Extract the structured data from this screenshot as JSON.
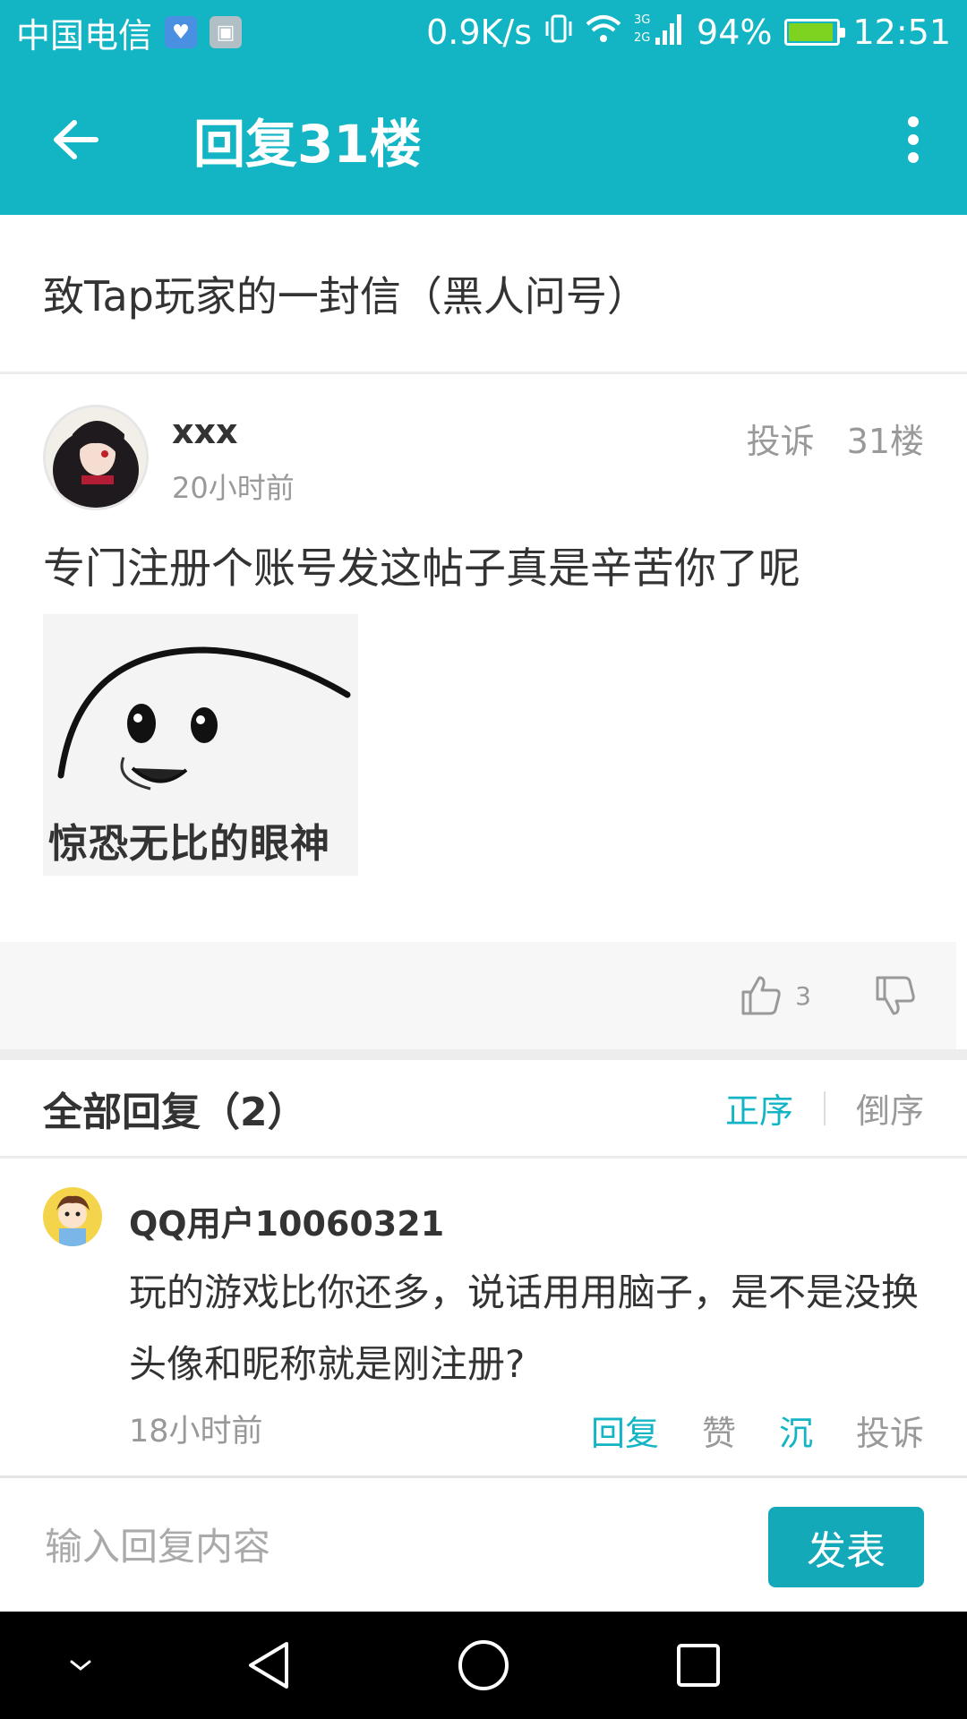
{
  "status_bar": {
    "carrier": "中国电信",
    "net_speed": "0.9K/s",
    "network": "3G 2G",
    "battery": "94%",
    "time": "12:51"
  },
  "app_bar": {
    "title": "回复31楼"
  },
  "post": {
    "title": "致Tap玩家的一封信（黑人问号）",
    "username": "xxx",
    "time": "20小时前",
    "report_label": "投诉",
    "floor": "31楼",
    "body": "专门注册个账号发这帖子真是辛苦你了呢",
    "image_caption": "惊恐无比的眼神",
    "like_count": "3"
  },
  "replies": {
    "header": "全部回复（2）",
    "sort_asc": "正序",
    "sort_desc": "倒序",
    "items": [
      {
        "username": "QQ用户10060321",
        "text": "玩的游戏比你还多，说话用用脑子，是不是没换头像和昵称就是刚注册?",
        "time": "18小时前",
        "reply_label": "回复",
        "like_label": "赞",
        "sink_label": "沉",
        "report_label": "投诉"
      }
    ]
  },
  "input_bar": {
    "placeholder": "输入回复内容",
    "submit_label": "发表"
  },
  "colors": {
    "accent": "#13b5c5",
    "text": "#333333",
    "muted": "#999999"
  }
}
